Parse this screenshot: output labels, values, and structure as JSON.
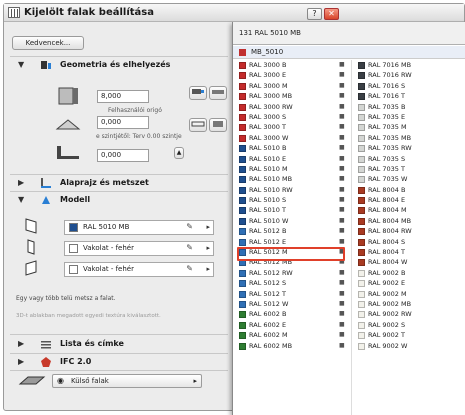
{
  "window": {
    "title": "Kijelölt falak beállítása",
    "help_label": "?",
    "close_label": "✕"
  },
  "toolbar": {
    "favorites_label": "Kedvencek..."
  },
  "sections": {
    "geometry": "Geometria és elhelyezés",
    "floorplan": "Alaprajz és metszet",
    "model": "Modell",
    "list": "Lista és címke",
    "ifc": "IFC 2.0"
  },
  "geometry": {
    "thickness": "8,000",
    "ref_label": "Felhasználói origó",
    "offset": "0,000",
    "base_label": "e szintjétől: Terv 0.00 szintje",
    "height": "0,000"
  },
  "model": {
    "materials": [
      {
        "label": "RAL 5010 MB",
        "color": "#1f4f8f"
      },
      {
        "label": "Vakolat - fehér",
        "color": "#ffffff"
      },
      {
        "label": "Vakolat - fehér",
        "color": "#ffffff"
      }
    ],
    "note1": "Egy vagy több telü metsz a falat.",
    "note2": "3D-t ablakban megadott egyedi textúra kiválasztott."
  },
  "bottom": {
    "dropdown_label": "Külső falak"
  },
  "popup": {
    "header": "131 RAL 5010 MB",
    "selected": "MB_5010",
    "highlighted": "RAL 5010 MB",
    "left_items": [
      {
        "label": "RAL 3000 B",
        "color": "#c42b2b"
      },
      {
        "label": "RAL 3000 E",
        "color": "#c42b2b"
      },
      {
        "label": "RAL 3000 M",
        "color": "#c42b2b"
      },
      {
        "label": "RAL 3000 MB",
        "color": "#c42b2b"
      },
      {
        "label": "RAL 3000 RW",
        "color": "#c42b2b"
      },
      {
        "label": "RAL 3000 S",
        "color": "#c42b2b"
      },
      {
        "label": "RAL 3000 T",
        "color": "#c42b2b"
      },
      {
        "label": "RAL 3000 W",
        "color": "#c42b2b"
      },
      {
        "label": "RAL 5010 B",
        "color": "#1f4f8f"
      },
      {
        "label": "RAL 5010 E",
        "color": "#1f4f8f"
      },
      {
        "label": "RAL 5010 M",
        "color": "#1f4f8f"
      },
      {
        "label": "RAL 5010 MB",
        "color": "#1f4f8f"
      },
      {
        "label": "RAL 5010 RW",
        "color": "#1f4f8f"
      },
      {
        "label": "RAL 5010 S",
        "color": "#1f4f8f"
      },
      {
        "label": "RAL 5010 T",
        "color": "#1f4f8f"
      },
      {
        "label": "RAL 5010 W",
        "color": "#1f4f8f"
      },
      {
        "label": "RAL 5012 B",
        "color": "#2f6fb5"
      },
      {
        "label": "RAL 5012 E",
        "color": "#2f6fb5"
      },
      {
        "label": "RAL 5012 M",
        "color": "#2f6fb5"
      },
      {
        "label": "RAL 5012 MB",
        "color": "#2f6fb5"
      },
      {
        "label": "RAL 5012 RW",
        "color": "#2f6fb5"
      },
      {
        "label": "RAL 5012 S",
        "color": "#2f6fb5"
      },
      {
        "label": "RAL 5012 T",
        "color": "#2f6fb5"
      },
      {
        "label": "RAL 5012 W",
        "color": "#2f6fb5"
      },
      {
        "label": "RAL 6002 B",
        "color": "#2e7d32"
      },
      {
        "label": "RAL 6002 E",
        "color": "#2e7d32"
      },
      {
        "label": "RAL 6002 M",
        "color": "#2e7d32"
      },
      {
        "label": "RAL 6002 MB",
        "color": "#2e7d32"
      }
    ],
    "right_items": [
      {
        "label": "RAL 7016 MB",
        "color": "#3a3f45"
      },
      {
        "label": "RAL 7016 RW",
        "color": "#3a3f45"
      },
      {
        "label": "RAL 7016 S",
        "color": "#3a3f45"
      },
      {
        "label": "RAL 7016 T",
        "color": "#3a3f45"
      },
      {
        "label": "RAL 7035 B",
        "color": "#d4d6d3"
      },
      {
        "label": "RAL 7035 E",
        "color": "#d4d6d3"
      },
      {
        "label": "RAL 7035 M",
        "color": "#d4d6d3"
      },
      {
        "label": "RAL 7035 MB",
        "color": "#d4d6d3"
      },
      {
        "label": "RAL 7035 RW",
        "color": "#d4d6d3"
      },
      {
        "label": "RAL 7035 S",
        "color": "#d4d6d3"
      },
      {
        "label": "RAL 7035 T",
        "color": "#d4d6d3"
      },
      {
        "label": "RAL 7035 W",
        "color": "#d4d6d3"
      },
      {
        "label": "RAL 8004 B",
        "color": "#a83a22"
      },
      {
        "label": "RAL 8004 E",
        "color": "#a83a22"
      },
      {
        "label": "RAL 8004 M",
        "color": "#a83a22"
      },
      {
        "label": "RAL 8004 MB",
        "color": "#a83a22"
      },
      {
        "label": "RAL 8004 RW",
        "color": "#a83a22"
      },
      {
        "label": "RAL 8004 S",
        "color": "#a83a22"
      },
      {
        "label": "RAL 8004 T",
        "color": "#a83a22"
      },
      {
        "label": "RAL 8004 W",
        "color": "#a83a22"
      },
      {
        "label": "RAL 9002 B",
        "color": "#f2f1ea"
      },
      {
        "label": "RAL 9002 E",
        "color": "#f2f1ea"
      },
      {
        "label": "RAL 9002 M",
        "color": "#f2f1ea"
      },
      {
        "label": "RAL 9002 MB",
        "color": "#f2f1ea"
      },
      {
        "label": "RAL 9002 RW",
        "color": "#f2f1ea"
      },
      {
        "label": "RAL 9002 S",
        "color": "#f2f1ea"
      },
      {
        "label": "RAL 9002 T",
        "color": "#f2f1ea"
      },
      {
        "label": "RAL 9002 W",
        "color": "#f2f1ea"
      }
    ]
  }
}
